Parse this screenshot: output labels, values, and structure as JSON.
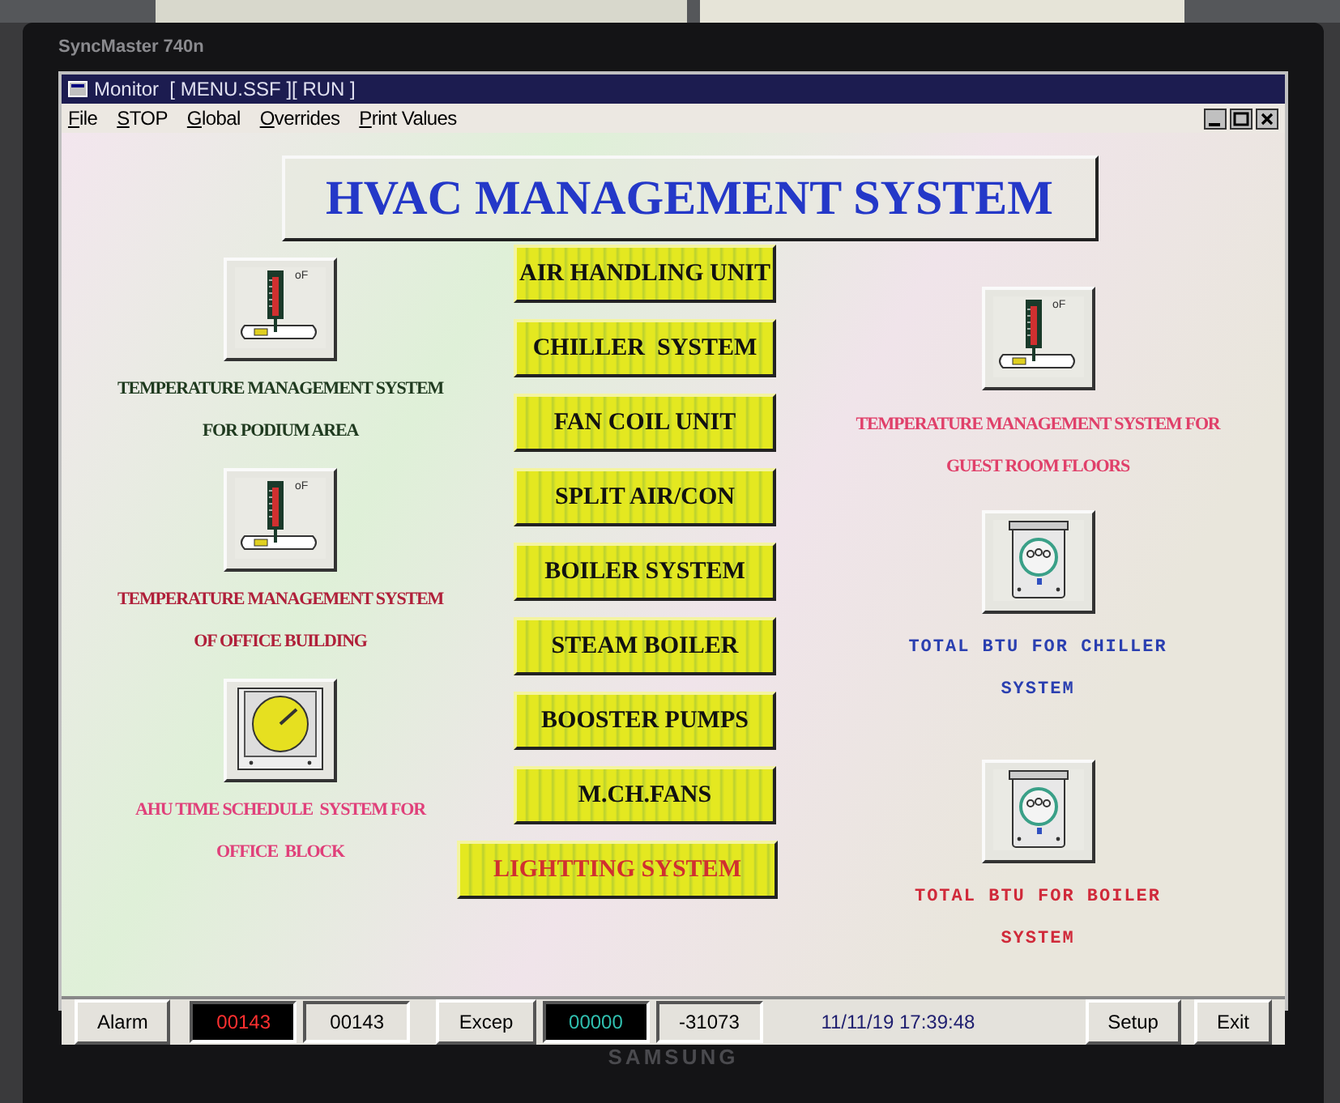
{
  "monitor": {
    "model": "SyncMaster 740n",
    "brand": "SAMSUNG"
  },
  "window": {
    "title": "Monitor  [ MENU.SSF ][ RUN ]"
  },
  "menu": [
    "File",
    "STOP",
    "Global",
    "Overrides",
    "Print Values"
  ],
  "heading": "HVAC MANAGEMENT SYSTEM",
  "left_panels": [
    {
      "kind": "thermometer",
      "unit": "oF",
      "color": "#1f3a1f",
      "lines": [
        "TEMPERATURE MANAGEMENT SYSTEM",
        "FOR PODIUM AREA"
      ]
    },
    {
      "kind": "thermometer",
      "unit": "oF",
      "color": "#b0203a",
      "lines": [
        "TEMPERATURE MANAGEMENT SYSTEM",
        "OF OFFICE BUILDING"
      ]
    },
    {
      "kind": "clock",
      "color": "#e0407a",
      "lines": [
        "AHU TIME SCHEDULE  SYSTEM FOR",
        "OFFICE  BLOCK"
      ]
    }
  ],
  "system_buttons": [
    {
      "label": "AIR HANDLING UNIT",
      "kind": "normal"
    },
    {
      "label": "CHILLER  SYSTEM",
      "kind": "normal"
    },
    {
      "label": "FAN COIL UNIT",
      "kind": "normal"
    },
    {
      "label": "SPLIT AIR/CON",
      "kind": "normal"
    },
    {
      "label": "BOILER SYSTEM",
      "kind": "normal"
    },
    {
      "label": "STEAM BOILER",
      "kind": "normal"
    },
    {
      "label": "BOOSTER PUMPS",
      "kind": "normal"
    },
    {
      "label": "M.CH.FANS",
      "kind": "normal"
    },
    {
      "label": "LIGHTTING SYSTEM",
      "kind": "wide"
    }
  ],
  "right_panels": [
    {
      "kind": "thermometer",
      "unit": "oF",
      "color": "#e0406a",
      "lines": [
        "TEMPERATURE MANAGEMENT SYSTEM FOR",
        "GUEST ROOM FLOORS"
      ]
    },
    {
      "kind": "meter",
      "color": "#2a3fb0",
      "lines": [
        "TOTAL BTU FOR CHILLER",
        "SYSTEM"
      ]
    },
    {
      "kind": "meter",
      "color": "#d02a3a",
      "lines": [
        "TOTAL BTU FOR BOILER",
        "SYSTEM"
      ]
    }
  ],
  "status_bar": {
    "alarm_button": "Alarm",
    "alarm_count": "00143",
    "alarm_total": "00143",
    "except_button": "Excep",
    "except_count": "00000",
    "value": "-31073",
    "datetime": "11/11/19 17:39:48",
    "buttons": [
      "Setup",
      "Exit"
    ]
  }
}
